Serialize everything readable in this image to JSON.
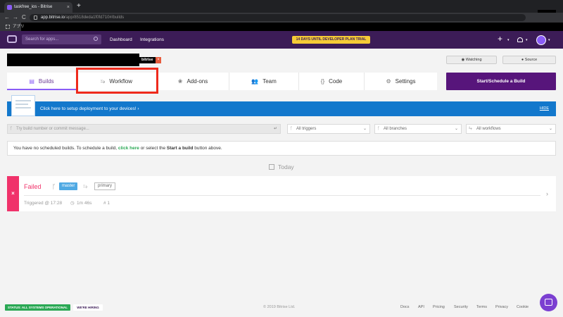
{
  "browser": {
    "tab_title": "taskfree_ios - Bitrise",
    "close_tab": "×",
    "new_tab": "+",
    "back": "←",
    "forward": "→",
    "reload": "C",
    "url_domain": "app.bitrise.io",
    "url_path": "/app/8518deda1f0fd710#/builds",
    "bookmark_apps": "アプリ"
  },
  "topnav": {
    "search_placeholder": "Search for apps...",
    "links": [
      "Dashboard",
      "Integrations"
    ],
    "trial_text": "14 DAYS UNTIL DEVELOPER PLAN TRIAL ENDS",
    "plus": "+",
    "caret": "▾"
  },
  "app": {
    "badge": "bitrise",
    "badge_close": "×",
    "watching_label": "Watching",
    "source_label": "Source"
  },
  "tabs": [
    {
      "label": "Builds",
      "icon": "▤",
      "icon_name": "builds-icon"
    },
    {
      "label": "Workflow",
      "icon": "⥲",
      "icon_name": "workflow-icon"
    },
    {
      "label": "Add-ons",
      "icon": "❀",
      "icon_name": "addons-icon"
    },
    {
      "label": "Team",
      "icon": "👥",
      "icon_name": "team-icon"
    },
    {
      "label": "Code",
      "icon": "{}",
      "icon_name": "code-icon"
    },
    {
      "label": "Settings",
      "icon": "⚙",
      "icon_name": "settings-icon"
    }
  ],
  "start_build_label": "Start/Schedule a Build",
  "banner": {
    "text": "Click here to setup deployment to your devices!",
    "chevron": "›",
    "hide": "HIDE"
  },
  "filters": {
    "search_placeholder": "Try build number or commit message...",
    "triggers": "All triggers",
    "branches": "All branches",
    "workflows": "All workflows",
    "dropdown_glyph": "⌄"
  },
  "notice": {
    "part1": "You have no scheduled builds. To schedule a build, ",
    "link": "click here",
    "part2": " or select the ",
    "bold": "Start a build",
    "part3": " button above."
  },
  "today_label": "Today",
  "build": {
    "status": "Failed",
    "status_glyph": "×",
    "branch_glyph": "ᚴ",
    "branch": "master",
    "workflow_glyph": "⥲",
    "workflow": "primary",
    "triggered": "Triggered @ 17:28",
    "duration": "1m 46s",
    "number": "# 1",
    "chevron": "›"
  },
  "footer": {
    "status": "STATUS: ALL SYSTEMS OPERATIONAL",
    "hiring": "WE'RE HIRING",
    "copyright": "© 2019 Bitrise Ltd.",
    "links": [
      "Docs",
      "API",
      "Pricing",
      "Security",
      "Terms",
      "Privacy",
      "Cookie"
    ]
  },
  "colors": {
    "nav_bg": "#3c1c57",
    "accent": "#8a5cf6",
    "start_button": "#57157b",
    "banner": "#1378cc",
    "failed": "#f0326a",
    "branch_badge": "#4fa9e3",
    "highlight_box": "#ee2a1c",
    "trial_badge": "#f5cb36"
  }
}
